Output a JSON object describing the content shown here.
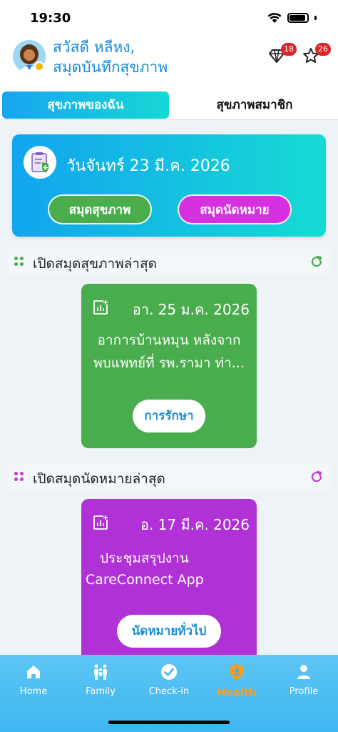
{
  "status_bar": {
    "time": "19:30"
  },
  "header": {
    "greeting_line1": "สวัสดี หลีหง,",
    "greeting_line2": "สมุดบันทึกสุขภาพ",
    "gem_badge": "18",
    "star_badge": "26"
  },
  "tabs": [
    {
      "label": "สุขภาพของฉัน",
      "active": true
    },
    {
      "label": "สุขภาพสมาชิก",
      "active": false
    }
  ],
  "date_card": {
    "date": "วันจันทร์ 23 มี.ค. 2026",
    "buttons": [
      {
        "label": "สมุดสุขภาพ",
        "color": "#4aad4d"
      },
      {
        "label": "สมุดนัดหมาย",
        "color": "#d531e0"
      }
    ]
  },
  "health_section": {
    "title": "เปิดสมุดสุขภาพล่าสุด",
    "card": {
      "date": "อา. 25 ม.ค. 2026",
      "desc_line1": "อาการบ้านหมุน หลังจาก",
      "desc_line2": "พบแพทย์ที่ รพ.รามา ท่า...",
      "button": "การรักษา",
      "color": "#4aad4d"
    }
  },
  "appointment_section": {
    "title": "เปิดสมุดนัดหมายล่าสุด",
    "card": {
      "date": "อ. 17 มี.ค. 2026",
      "desc_line1": "ประชุมสรุปงาน",
      "desc_line2": "CareConnect App",
      "button": "นัดหมายทั่วไป",
      "color": "#b032d6"
    }
  },
  "bottom_nav": [
    {
      "label": "Home",
      "icon": "home-icon"
    },
    {
      "label": "Family",
      "icon": "family-icon"
    },
    {
      "label": "Check-in",
      "icon": "check-in-icon"
    },
    {
      "label": "Health",
      "icon": "health-shield-icon",
      "active": true
    },
    {
      "label": "Profile",
      "icon": "profile-icon"
    }
  ]
}
